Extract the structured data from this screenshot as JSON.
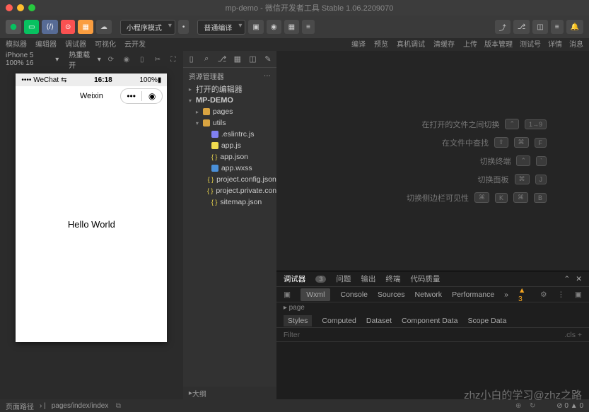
{
  "titlebar": {
    "title": "mp-demo - 微信开发者工具 Stable 1.06.2209070"
  },
  "toolbar": {
    "labels": [
      "模拟器",
      "编辑器",
      "调试器",
      "可视化",
      "云开发"
    ],
    "mode": "小程序模式",
    "compile": "普通编译",
    "actions": {
      "compile_btn": "编译",
      "preview": "预览",
      "real": "真机调试",
      "clear": "清缓存"
    },
    "right": {
      "upload": "上传",
      "version": "版本管理",
      "test": "测试号",
      "detail": "详情",
      "msg": "消息"
    }
  },
  "sim": {
    "device": "iPhone 5 100% 16",
    "hot": "热重载 开",
    "carrier": "•••• WeChat",
    "signal": "⇆",
    "time": "16:18",
    "battery": "100%",
    "nav": "Weixin",
    "content": "Hello World"
  },
  "explorer": {
    "title": "资源管理器",
    "sections": [
      "打开的编辑器",
      "MP-DEMO"
    ],
    "tree": [
      {
        "name": "pages",
        "type": "folder",
        "depth": 1,
        "exp": false
      },
      {
        "name": "utils",
        "type": "folder",
        "depth": 1,
        "exp": true
      },
      {
        "name": ".eslintrc.js",
        "type": "esl",
        "depth": 2
      },
      {
        "name": "app.js",
        "type": "js",
        "depth": 2
      },
      {
        "name": "app.json",
        "type": "json",
        "depth": 2
      },
      {
        "name": "app.wxss",
        "type": "wxss",
        "depth": 2
      },
      {
        "name": "project.config.json",
        "type": "json",
        "depth": 2
      },
      {
        "name": "project.private.config...",
        "type": "json",
        "depth": 2
      },
      {
        "name": "sitemap.json",
        "type": "json",
        "depth": 2
      }
    ],
    "outline": "大纲"
  },
  "tips": [
    {
      "label": "在打开的文件之间切换",
      "keys": [
        "⌃",
        "1→9"
      ]
    },
    {
      "label": "在文件中查找",
      "keys": [
        "⇧",
        "⌘",
        "F"
      ]
    },
    {
      "label": "切换终端",
      "keys": [
        "⌃",
        "`"
      ]
    },
    {
      "label": "切换面板",
      "keys": [
        "⌘",
        "J"
      ]
    },
    {
      "label": "切换侧边栏可见性",
      "keys": [
        "⌘",
        "K",
        "⌘",
        "B"
      ]
    }
  ],
  "devtools": {
    "tabs1": [
      "调试器",
      "问题",
      "输出",
      "终端",
      "代码质量"
    ],
    "badge": "3",
    "tabs2": [
      "Wxml",
      "Console",
      "Sources",
      "Network",
      "Performance"
    ],
    "warn": "3",
    "styles": [
      "Styles",
      "Computed",
      "Dataset",
      "Component Data",
      "Scope Data"
    ],
    "filter": "Filter",
    "cls": ".cls"
  },
  "status": {
    "path": "页面路径",
    "page": "pages/index/index",
    "err": "0",
    "warn": "0"
  },
  "watermark": "zhz小白的学习@zhz之路"
}
